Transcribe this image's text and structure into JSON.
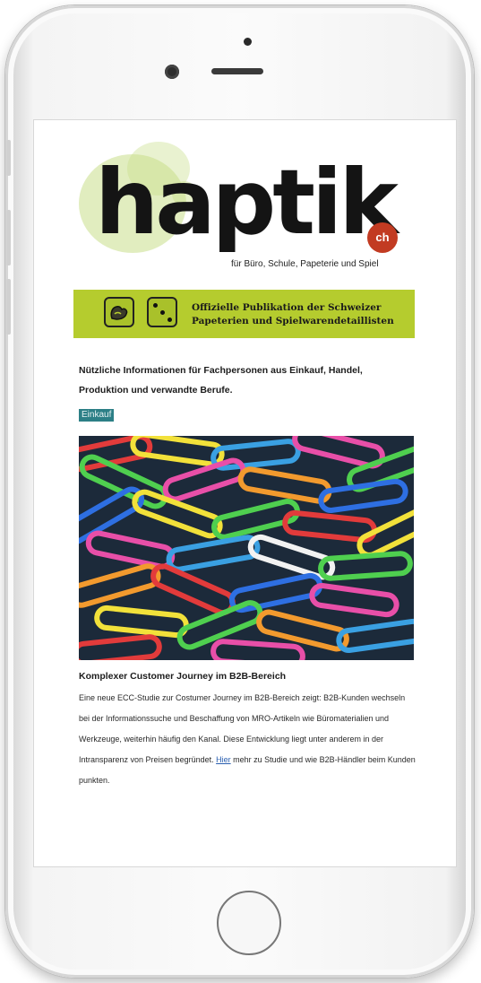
{
  "logo": {
    "word": "haptik",
    "badge": "ch",
    "tagline": "für Büro, Schule, Papeterie und Spiel"
  },
  "banner": {
    "line1": "Offizielle Publikation der Schweizer",
    "line2": "Papeterien und Spielwarendetaillisten"
  },
  "intro": "Nützliche Informationen für Fachpersonen aus Einkauf, Handel, Produktion und verwandte Berufe.",
  "category_tag": "Einkauf",
  "article": {
    "title": "Komplexer Customer Journey im B2B-Bereich",
    "body_before_link": "Eine neue ECC-Studie zur Costumer Journey im B2B-Bereich zeigt: B2B-Kunden wechseln bei der Informationssuche und Beschaffung von MRO-Artikeln wie Büromaterialien und Werkzeuge, weiterhin häufig den Kanal. Diese Entwicklung liegt unter anderem in der Intransparenz von Preisen begründet. ",
    "link_text": "Hier",
    "body_after_link": " mehr zu Studie und wie B2B-Händler beim Kunden punkten."
  },
  "colors": {
    "banner": "#b5cc2e",
    "tag": "#2c7f86",
    "logo_badge": "#c23b22",
    "link": "#2a5fb0"
  },
  "icons": [
    "gloves-icon",
    "dice-icon"
  ]
}
